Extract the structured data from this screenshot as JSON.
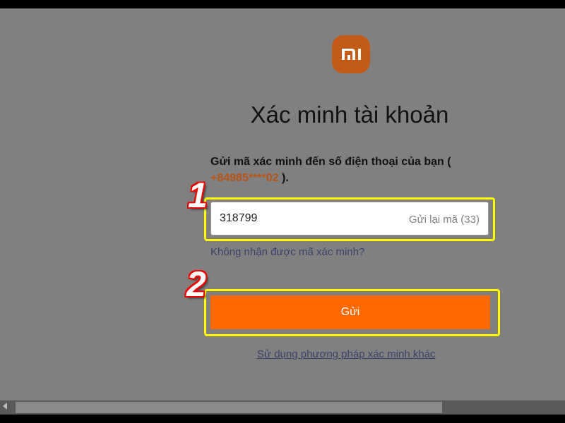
{
  "logo": {
    "text": "mi",
    "color": "#c45a17"
  },
  "title": "Xác minh tài khoản",
  "description": {
    "prefix": "Gửi mã xác minh đến số điện thoại của bạn (",
    "phone": "+84985****02",
    "suffix": ")."
  },
  "code_input": {
    "value": "318799",
    "resend_label": "Gửi lại mã (33)"
  },
  "no_code_link": "Không nhận được mã xác minh?",
  "submit_label": "Gửi",
  "other_method_link": "Sử dụng phương pháp xác minh khác",
  "steps": {
    "one": "1",
    "two": "2"
  },
  "colors": {
    "accent": "#ff6900",
    "highlight": "#ffff00",
    "phone": "#b85416"
  }
}
